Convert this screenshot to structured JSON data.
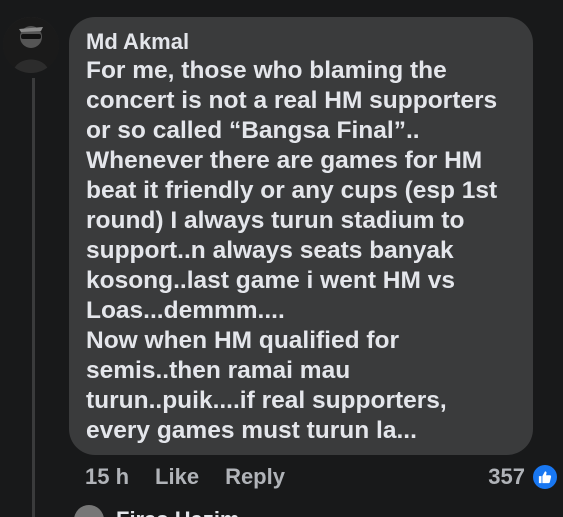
{
  "comment": {
    "author": "Md Akmal",
    "lines": [
      "For me, those who blaming the",
      "concert is not a real HM supporters",
      "or so called “Bangsa Final”..",
      "Whenever there are games for HM",
      "beat it friendly or any cups (esp 1st",
      "round) I always turun stadium to",
      "support..n always seats banyak",
      "kosong..last game i went HM vs",
      "Loas...demmm....",
      "Now when HM qualified for",
      "semis..then ramai mau",
      "turun..puik....if real supporters,",
      "every games must turun la..."
    ],
    "time": "15 h",
    "like_label": "Like",
    "reply_label": "Reply",
    "reaction_count": "357",
    "reaction_icon": "thumbs-up-icon"
  },
  "next_comment": {
    "preview_text": "Firas Hazim"
  },
  "colors": {
    "background": "#18191a",
    "bubble": "#3a3b3c",
    "text": "#e4e6eb",
    "meta_text": "#b0b3b8",
    "like_blue": "#1877f2"
  }
}
